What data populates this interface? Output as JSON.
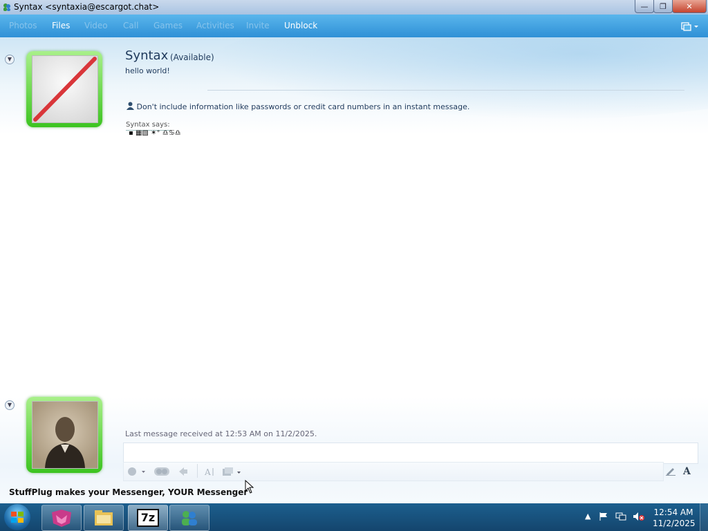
{
  "window": {
    "title": "Syntax <syntaxia@escargot.chat>"
  },
  "menu": {
    "items": [
      {
        "label": "Photos",
        "enabled": false
      },
      {
        "label": "Files",
        "enabled": true
      },
      {
        "label": "Video",
        "enabled": false
      },
      {
        "label": "Call",
        "enabled": false
      },
      {
        "label": "Games",
        "enabled": false
      },
      {
        "label": "Activities",
        "enabled": false
      },
      {
        "label": "Invite",
        "enabled": false
      },
      {
        "label": "Unblock",
        "enabled": true
      }
    ]
  },
  "contact": {
    "name": "Syntax",
    "status": "(Available)",
    "personal_message": "hello world!"
  },
  "conversation": {
    "warning": "Don't include information like passwords or credit card numbers in an instant message.",
    "sender_line": "Syntax says:",
    "message": "▪ ▦▧  ✶⁺  ♎♋♎"
  },
  "compose": {
    "last_message": "Last message received at 12:53 AM on 11/2/2025.",
    "input_value": ""
  },
  "ad": {
    "text": "StuffPlug makes your Messenger, YOUR Messenger"
  },
  "taskbar": {
    "apps": [
      "fox-app-icon",
      "file-explorer-icon",
      "7zip-icon",
      "messenger-icon"
    ],
    "seven_zip_label": "7z",
    "clock_time": "12:54 AM",
    "clock_date": "11/2/2025"
  }
}
